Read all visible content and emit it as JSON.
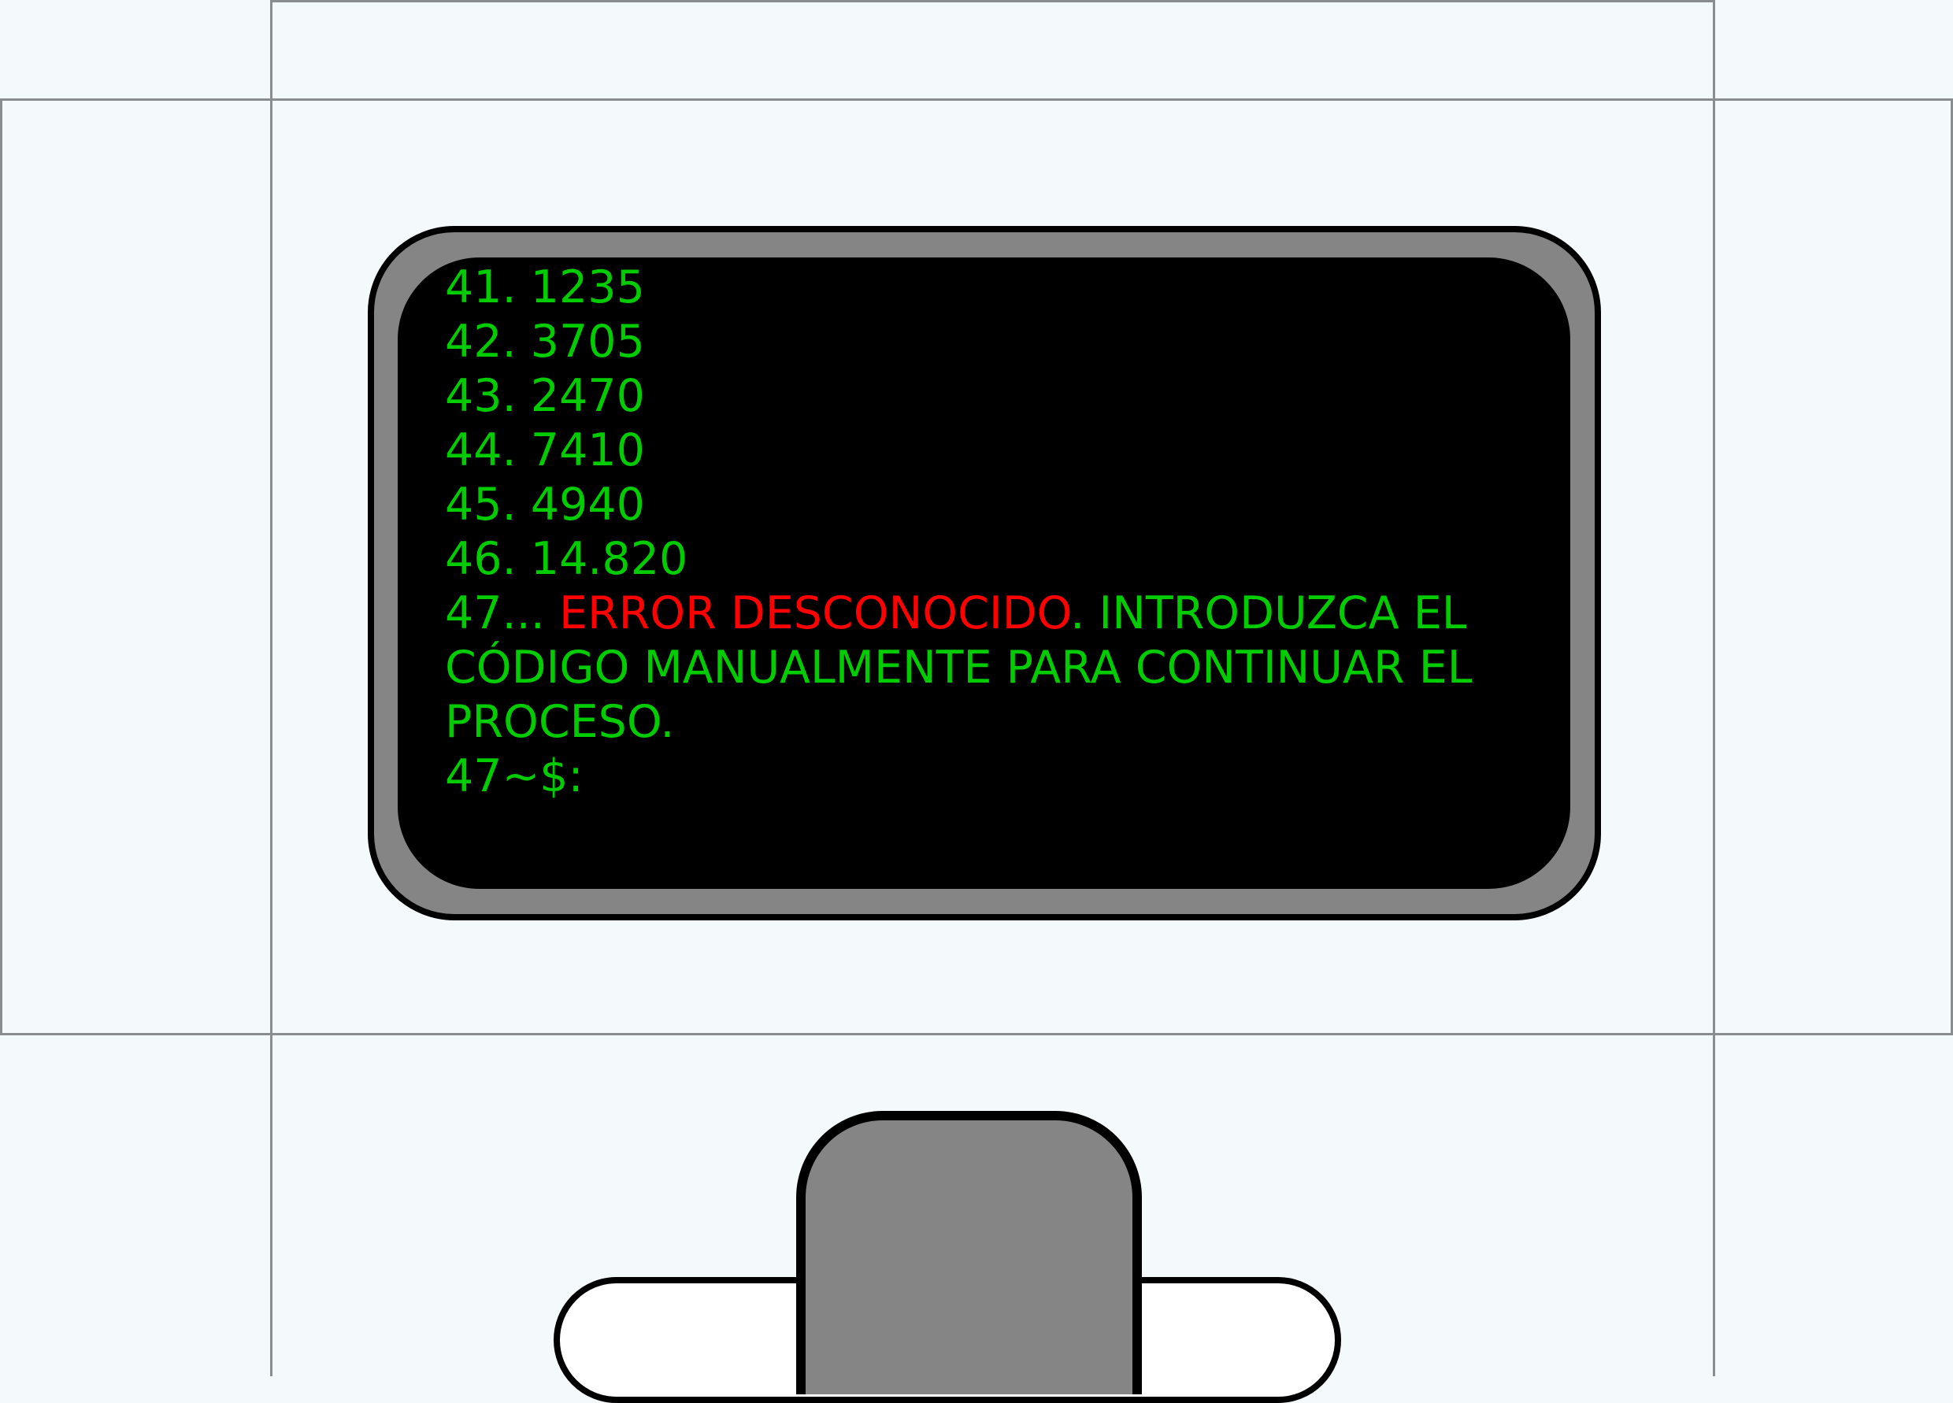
{
  "terminal": {
    "lines": [
      "41. 1235",
      "42. 3705",
      "43. 2470",
      "44. 7410",
      "45. 4940",
      "46. 14.820"
    ],
    "error_prefix": "47... ",
    "error_text": "ERROR DESCONOCIDO",
    "error_suffix": ". INTRODUZCA EL CÓDIGO MANUALMENTE PARA CONTINUAR EL PROCESO.",
    "prompt": "47~$:"
  },
  "colors": {
    "page_background": "#f4f9fc",
    "terminal_text": "#00cc00",
    "error_text": "#ff0000",
    "screen": "#000000",
    "bezel": "#858585"
  }
}
